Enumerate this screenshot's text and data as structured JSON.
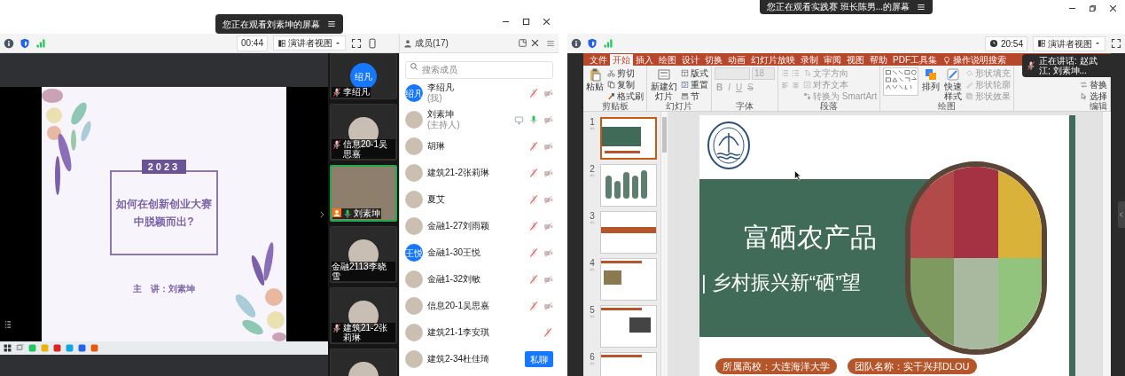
{
  "left_screen": {
    "banner": "您正在观看刘素坤的屏幕",
    "timer": "00:44",
    "view_button": "演讲者视图",
    "members_title": "成员(17)",
    "slide": {
      "year": "2023",
      "title_lines": [
        "如何在创新创业大赛",
        "中脱颖而出?"
      ],
      "speaker": "主　讲：刘素坤"
    },
    "video_tiles": [
      {
        "kind": "initials",
        "avatar_text": "绍凡",
        "name": "李绍凡",
        "mic_icon": true,
        "muted": true,
        "speaking": false
      },
      {
        "kind": "photo",
        "name": "信息20-1吴思嘉",
        "mic_icon": true,
        "muted": true,
        "speaking": false
      },
      {
        "kind": "video",
        "name": "刘素坤",
        "mic_icon": true,
        "muted": false,
        "speaking": true
      },
      {
        "kind": "photo",
        "name": "金融2113李晓雪",
        "mic_icon": false,
        "speaking": false
      },
      {
        "kind": "photo",
        "name": "建筑21-2张莉琳",
        "mic_icon": true,
        "muted": true,
        "speaking": false
      },
      {
        "kind": "photo",
        "mic_icon": false,
        "speaking": false
      }
    ],
    "members": {
      "search_placeholder": "搜索成员",
      "items": [
        {
          "name": "李绍凡",
          "role": "(我)",
          "kind": "initials",
          "avatar_text": "绍凡",
          "mic_icon": true,
          "muted": true,
          "video_off": true,
          "sharing": false
        },
        {
          "name": "刘素坤",
          "role": "(主持人)",
          "kind": "photo",
          "mic_icon": true,
          "muted": false,
          "video_off": true,
          "sharing": true
        },
        {
          "name": "胡琳",
          "kind": "photo",
          "mic_icon": true,
          "muted": true,
          "video_off": true,
          "sharing": false
        },
        {
          "name": "建筑21-2张莉琳",
          "kind": "photo",
          "mic_icon": true,
          "muted": true,
          "video_off": true,
          "sharing": false
        },
        {
          "name": "夏艾",
          "kind": "photo",
          "mic_icon": true,
          "muted": true,
          "video_off": true,
          "sharing": false
        },
        {
          "name": "金融1-27刘雨颖",
          "kind": "photo",
          "mic_icon": true,
          "muted": true,
          "video_off": true,
          "sharing": false
        },
        {
          "name": "金融1-30王悦",
          "kind": "initials",
          "avatar_text": "王悦",
          "mic_icon": true,
          "muted": true,
          "video_off": true,
          "sharing": false
        },
        {
          "name": "金融1-32刘敏",
          "kind": "photo",
          "mic_icon": true,
          "muted": true,
          "video_off": true,
          "sharing": false
        },
        {
          "name": "信息20-1吴思嘉",
          "kind": "photo",
          "mic_icon": true,
          "muted": true,
          "video_off": true,
          "sharing": false
        },
        {
          "name": "建筑21-1李安琪",
          "kind": "photo",
          "mic_icon": true,
          "muted": true,
          "video_off": false,
          "sharing": false
        },
        {
          "name": "建筑2-34杜佳琦",
          "kind": "photo",
          "mic_icon": false,
          "video_off": false,
          "sharing": false,
          "button": "私聊"
        }
      ]
    }
  },
  "right_screen": {
    "banner": "您正在观看实践赛 班长陈男...的屏幕",
    "clock": "20:54",
    "view_button": "演讲者视图",
    "ribbon": {
      "tabs": [
        {
          "label": "文件",
          "selected": false
        },
        {
          "label": "开始",
          "selected": true
        },
        {
          "label": "插入",
          "selected": false
        },
        {
          "label": "绘图",
          "selected": false
        },
        {
          "label": "设计",
          "selected": false
        },
        {
          "label": "切换",
          "selected": false
        },
        {
          "label": "动画",
          "selected": false
        },
        {
          "label": "幻灯片放映",
          "selected": false
        },
        {
          "label": "录制",
          "selected": false
        },
        {
          "label": "审阅",
          "selected": false
        },
        {
          "label": "视图",
          "selected": false
        },
        {
          "label": "帮助",
          "selected": false
        },
        {
          "label": "PDF工具集",
          "selected": false
        }
      ],
      "search": "操作说明搜索",
      "groups": [
        {
          "kind": "clipboard",
          "label": "剪贴板",
          "large": [
            "粘贴"
          ],
          "small": [
            "剪切",
            "复制",
            "格式刷"
          ]
        },
        {
          "kind": "slides",
          "label": "幻灯片",
          "large": [
            "新建幻灯片"
          ],
          "small": [
            "版式",
            "重置",
            "节"
          ]
        },
        {
          "kind": "font",
          "label": "字体",
          "font_size": "18",
          "format_buttons": [
            "B",
            "I",
            "U",
            "S"
          ]
        },
        {
          "kind": "paragraph",
          "label": "段落",
          "small": [
            "文字方向",
            "对齐文本",
            "转换为 SmartArt"
          ]
        },
        {
          "kind": "drawing",
          "label": "绘图",
          "large": [
            "排列",
            "快速样式"
          ],
          "small": [
            "形状填充",
            "形状轮廓",
            "形状效果"
          ]
        },
        {
          "kind": "editing",
          "label": "编辑",
          "small": [
            "替换",
            "选择"
          ]
        }
      ]
    },
    "speaking": "正在讲话: 赵武江; 刘素坤...",
    "thumbnails": [
      {
        "number": "1",
        "kind": "title",
        "selected": true
      },
      {
        "number": "2",
        "kind": "pillars",
        "selected": false
      },
      {
        "number": "3",
        "kind": "section",
        "selected": false
      },
      {
        "number": "4",
        "kind": "photo_text",
        "selected": false
      },
      {
        "number": "5",
        "kind": "screen_text",
        "selected": false
      },
      {
        "number": "6",
        "kind": "header",
        "selected": false
      }
    ],
    "slide": {
      "title": "富硒农产品",
      "subtitle": "| 乡村振兴新“硒”望",
      "tags": [
        "所属高校：大连海洋大学",
        "团队名称：实干兴邦DLOU"
      ]
    }
  }
}
